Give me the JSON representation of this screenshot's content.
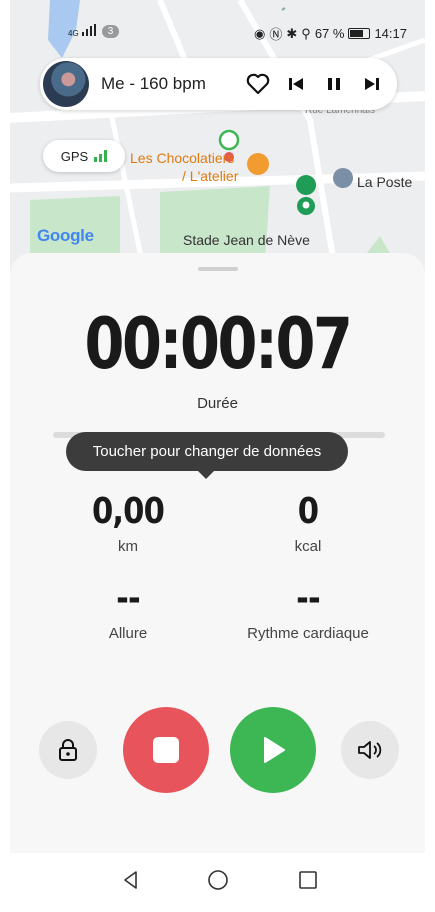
{
  "status_bar": {
    "signal_label": "4G",
    "sim_badge": "3",
    "battery_percent": "67 %",
    "time": "14:17"
  },
  "music": {
    "track": "Me - 160 bpm",
    "icons": [
      "heart-icon",
      "previous-icon",
      "pause-icon",
      "next-icon"
    ]
  },
  "gps": {
    "label": "GPS",
    "color": "#34b350"
  },
  "map": {
    "logo": "Google",
    "poi_restaurant_line1": "Les Chocolatiers",
    "poi_restaurant_line2": "/ L'atelier",
    "poi_post": "La Poste",
    "poi_stadium": "Stade Jean de Nève",
    "street": "Rue Lamennais"
  },
  "workout": {
    "timer": "00:00:07",
    "timer_label": "Durée",
    "tooltip": "Toucher pour changer de données",
    "distance_value": "0,00",
    "distance_unit": "km",
    "calories_value": "0",
    "calories_unit": "kcal",
    "pace_value": "--",
    "pace_label": "Allure",
    "heart_value": "--",
    "heart_label": "Rythme cardiaque"
  },
  "controls": {
    "lock": "lock-icon",
    "stop": "stop-icon",
    "play": "play-icon",
    "sound": "speaker-icon",
    "stop_color": "#e8545c",
    "play_color": "#3cb754"
  },
  "navigation": [
    "back-icon",
    "home-icon",
    "recents-icon"
  ]
}
